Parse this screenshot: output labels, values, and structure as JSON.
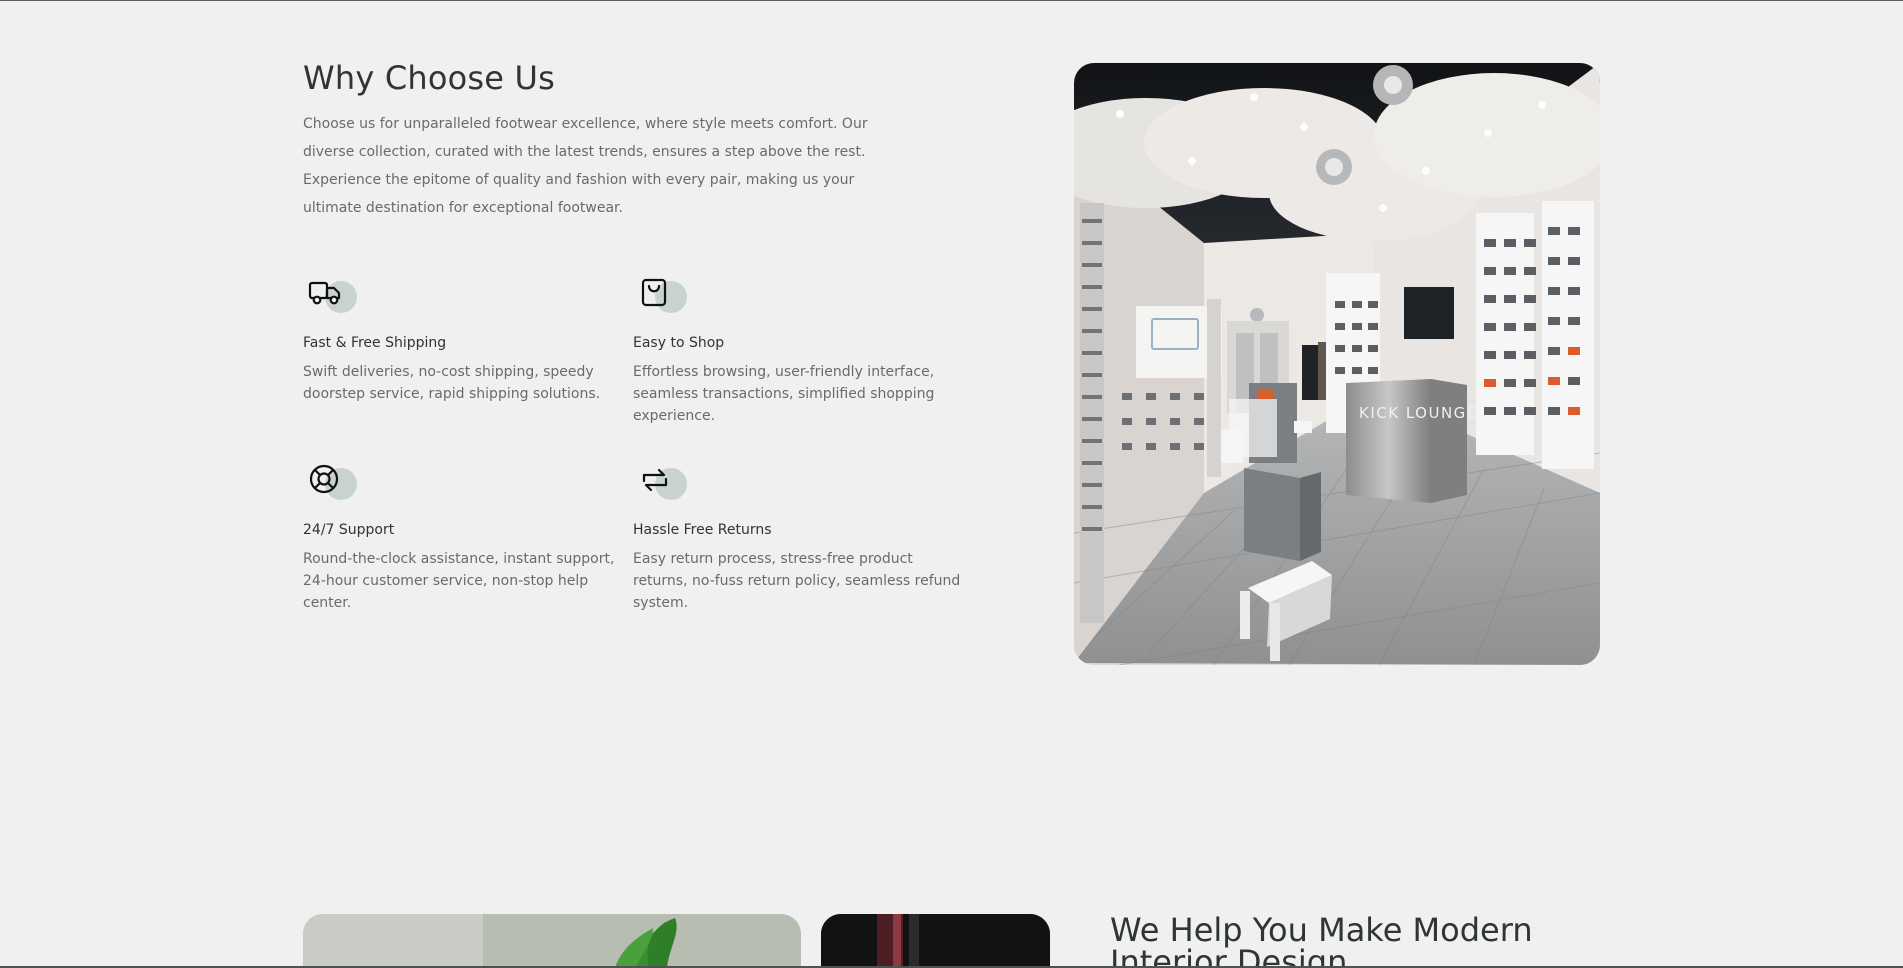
{
  "why_section": {
    "title": "Why Choose Us",
    "intro": "Choose us for unparalleled footwear excellence, where style meets comfort. Our diverse collection, curated with the latest trends, ensures a step above the rest. Experience the epitome of quality and fashion with every pair, making us your ultimate destination for exceptional footwear.",
    "features": [
      {
        "icon": "truck-icon",
        "title": "Fast & Free Shipping",
        "description": "Swift deliveries, no-cost shipping, speedy doorstep service, rapid shipping solutions."
      },
      {
        "icon": "shopping-bag-icon",
        "title": "Easy to Shop",
        "description": "Effortless browsing, user-friendly interface, seamless transactions, simplified shopping experience."
      },
      {
        "icon": "support-icon",
        "title": "24/7 Support",
        "description": "Round-the-clock assistance, instant support, 24-hour customer service, non-stop help center."
      },
      {
        "icon": "returns-icon",
        "title": "Hassle Free Returns",
        "description": "Easy return process, stress-free product returns, no-fuss return policy, seamless refund system."
      }
    ]
  },
  "store_image": {
    "signage": "KICK LOUNGE"
  },
  "help_section": {
    "title": "We Help You Make Modern Interior Design"
  },
  "colors": {
    "background": "#eff0ef",
    "text_primary": "#2f3435",
    "text_secondary": "#6a6a6a",
    "icon_accent": "#c8d2ce"
  }
}
